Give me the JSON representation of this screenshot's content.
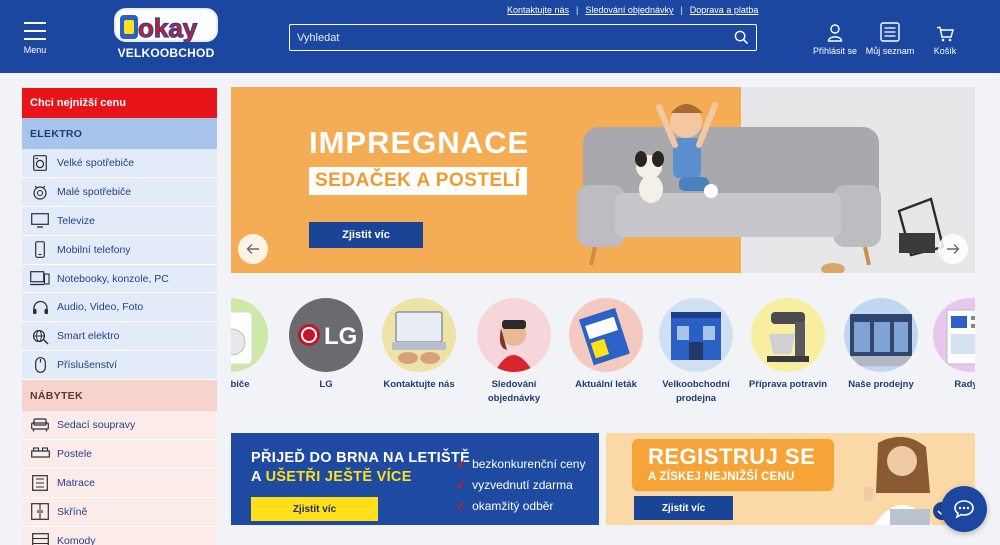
{
  "header": {
    "menu_label": "Menu",
    "logo_text": "okay",
    "logo_sub": "VELKOOBCHOD",
    "top_links": [
      "Kontaktujte nás",
      "Sledování objednávky",
      "Doprava a platba"
    ],
    "search_placeholder": "Vyhledat",
    "login_label": "Přihlásit se",
    "list_label": "Můj seznam",
    "cart_label": "Košík"
  },
  "sidebar": {
    "cheap_label": "Chci nejnižší cenu",
    "elektro_title": "ELEKTRO",
    "elektro_items": [
      {
        "label": "Velké spotřebiče",
        "icon": "washer-icon"
      },
      {
        "label": "Malé spotřebiče",
        "icon": "small-appliance-icon"
      },
      {
        "label": "Televize",
        "icon": "tv-icon"
      },
      {
        "label": "Mobilní telefony",
        "icon": "phone-icon"
      },
      {
        "label": "Notebooky, konzole, PC",
        "icon": "laptop-icon"
      },
      {
        "label": "Audio, Video, Foto",
        "icon": "headphones-icon"
      },
      {
        "label": "Smart elektro",
        "icon": "smart-icon"
      },
      {
        "label": "Příslušenství",
        "icon": "mouse-icon"
      }
    ],
    "nabytek_title": "NÁBYTEK",
    "nabytek_items": [
      {
        "label": "Sedací soupravy",
        "icon": "sofa-icon"
      },
      {
        "label": "Postele",
        "icon": "bed-icon"
      },
      {
        "label": "Matrace",
        "icon": "mattress-icon"
      },
      {
        "label": "Skříně",
        "icon": "wardrobe-icon"
      },
      {
        "label": "Komody",
        "icon": "dresser-icon"
      }
    ]
  },
  "hero": {
    "title": "IMPREGNACE",
    "subtitle": "SEDAČEK A POSTELÍ",
    "button": "Zjistit víc"
  },
  "categories": [
    {
      "label": "otřebiče"
    },
    {
      "label": "LG"
    },
    {
      "label": "Kontaktujte nás"
    },
    {
      "label": "Sledování objednávky"
    },
    {
      "label": "Aktuální leták"
    },
    {
      "label": "Velkoobchodní prodejna"
    },
    {
      "label": "Příprava potravin"
    },
    {
      "label": "Naše prodejny"
    },
    {
      "label": "Rady a"
    }
  ],
  "banner_left": {
    "line1": "PŘIJEĎ DO BRNA NA LETIŠTĚ",
    "line2_prefix": "A ",
    "line2_highlight": "UŠETŘI JEŠTĚ VÍCE",
    "checks": [
      "bezkonkurenční ceny",
      "vyzvednutí zdarma",
      "okamžitý odběr"
    ],
    "button": "Zjistit víc"
  },
  "banner_right": {
    "title": "REGISTRUJ SE",
    "subtitle": "A ZÍSKEJ NEJNIŽŠÍ CENU",
    "button": "Zjistit víc"
  },
  "colors": {
    "brand_blue": "#1c47a0",
    "accent_red": "#e8141a",
    "accent_yellow": "#ffe01b",
    "hero_orange": "#f4ac55"
  }
}
